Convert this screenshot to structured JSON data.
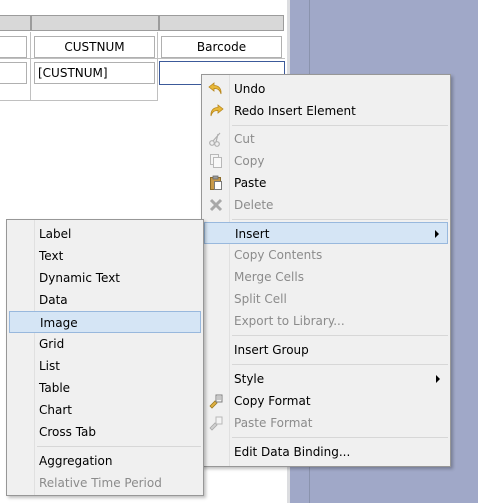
{
  "table": {
    "header_row": [
      "CUSTNUM",
      "Barcode"
    ],
    "data_row": [
      "[CUSTNUM]",
      ""
    ]
  },
  "context_menu": {
    "items": [
      {
        "label": "Undo",
        "enabled": true,
        "icon": "undo-arrow-icon"
      },
      {
        "label": "Redo Insert Element",
        "enabled": true,
        "icon": "redo-arrow-icon"
      },
      {
        "label": "Cut",
        "enabled": false,
        "icon": "scissors-icon"
      },
      {
        "label": "Copy",
        "enabled": false,
        "icon": "copy-icon"
      },
      {
        "label": "Paste",
        "enabled": true,
        "icon": "clipboard-icon"
      },
      {
        "label": "Delete",
        "enabled": false,
        "icon": "delete-x-icon"
      },
      {
        "label": "Insert",
        "enabled": true,
        "highlighted": true,
        "submenu": true
      },
      {
        "label": "Copy Contents",
        "enabled": false
      },
      {
        "label": "Merge Cells",
        "enabled": false
      },
      {
        "label": "Split Cell",
        "enabled": false
      },
      {
        "label": "Export to Library...",
        "enabled": false
      },
      {
        "label": "Insert Group",
        "enabled": true
      },
      {
        "label": "Style",
        "enabled": true,
        "submenu": true
      },
      {
        "label": "Copy Format",
        "enabled": true,
        "icon": "copy-format-brush-icon"
      },
      {
        "label": "Paste Format",
        "enabled": false,
        "icon": "paste-format-brush-icon"
      },
      {
        "label": "Edit Data Binding...",
        "enabled": true
      }
    ]
  },
  "insert_submenu": {
    "items": [
      {
        "label": "Label",
        "enabled": true
      },
      {
        "label": "Text",
        "enabled": true
      },
      {
        "label": "Dynamic Text",
        "enabled": true
      },
      {
        "label": "Data",
        "enabled": true
      },
      {
        "label": "Image",
        "enabled": true,
        "highlighted": true
      },
      {
        "label": "Grid",
        "enabled": true
      },
      {
        "label": "List",
        "enabled": true
      },
      {
        "label": "Table",
        "enabled": true
      },
      {
        "label": "Chart",
        "enabled": true
      },
      {
        "label": "Cross Tab",
        "enabled": true
      },
      {
        "label": "Aggregation",
        "enabled": true
      },
      {
        "label": "Relative Time Period",
        "enabled": false
      }
    ]
  },
  "colors": {
    "highlight_bg": "#d5e5f5",
    "highlight_border": "#98b8dd",
    "menu_bg": "#f0f0f0",
    "workspace_bg": "#a0a8c8",
    "disabled_text": "#8b8b8b"
  }
}
